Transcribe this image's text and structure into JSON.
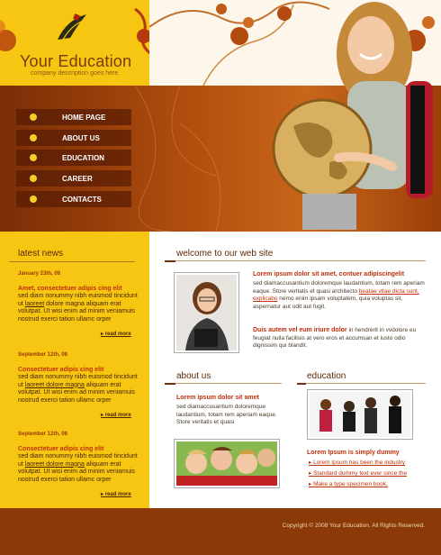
{
  "brand": {
    "title": "Your Education",
    "subtitle": "company description goes here"
  },
  "nav": [
    {
      "label": "HOME PAGE"
    },
    {
      "label": "ABOUT US"
    },
    {
      "label": "EDUCATION"
    },
    {
      "label": "CAREER"
    },
    {
      "label": "CONTACTS"
    }
  ],
  "sidebar": {
    "heading": "latest news",
    "news": [
      {
        "date": "January 23th, 08",
        "title": "Amet, consectetuer adipis cing elit",
        "body_start": "sed diam nonummy nibh euismod tincidunt ut ",
        "link": "laoreet",
        "body_end": " dolore magna aliquam erat volutpat.   Ut wisi enim ad minim veniamuis nostrud exerci tation ullamc orper",
        "more": "read more"
      },
      {
        "date": "September 12th, 08",
        "title": "Consectetuer adipis cing elit",
        "body_start": "sed diam nonummy nibh euismod tincidunt ut ",
        "link": "laoreet dolore magna",
        "body_end": " aliquam erat volutpat.   Ut wisi enim ad minim veniamuis nostrud exerci tation ullamc orper",
        "more": "read more"
      },
      {
        "date": "September 12th, 08",
        "title": "Consectetuer adipis cing elit",
        "body_start": "sed diam nonummy nibh euismod tincidunt ut ",
        "link": "laoreet dolore magna",
        "body_end": " aliquam erat volutpat.   Ut wisi enim ad minim veniamuis nostrud exerci tation ullamc orper",
        "more": "read more"
      }
    ]
  },
  "welcome": {
    "heading": "welcome to our web site",
    "p1_title": "Lorem ipsum dolor sit amet, contuer adipiscingelit",
    "p1_a": "sed diamaccusantium doloremque laudantium, totam rem aperiam eaque. Store veritatis et quasi architecto ",
    "p1_link1": "beatae vitae dicta sunt, explicabo",
    "p1_b": " nemo enim ipsam voluptatem, quia voluptas sit, aspernatur aut odit aut fugit.",
    "p2_title": "Duis autem vel eum iriure dolor",
    "p2_body": " in hendrerit in vvdolore eu feugiat nulla facilisis at vero eros et accumsan et iusto odio dignissim qui blandit."
  },
  "about": {
    "heading": "about us",
    "title": "Lorem ipsum dolor sit amet",
    "body": "sed diamaccusantium doloremque laudantium, totam rem aperiam eaque. Store veritatis et quasi"
  },
  "education": {
    "heading": "education",
    "title": "Lorem Ipsum is simply dummy",
    "links": [
      "Lorem Ipsum has been the industry",
      "Standard dummy text ever since the",
      "Make a type specimen book."
    ]
  },
  "footer": {
    "copyright": "Copyright © 2008 Your Education. All Rights Reserved."
  },
  "colors": {
    "yellow": "#f7c613",
    "brown": "#8b3a07",
    "accent_red": "#c0300a"
  }
}
